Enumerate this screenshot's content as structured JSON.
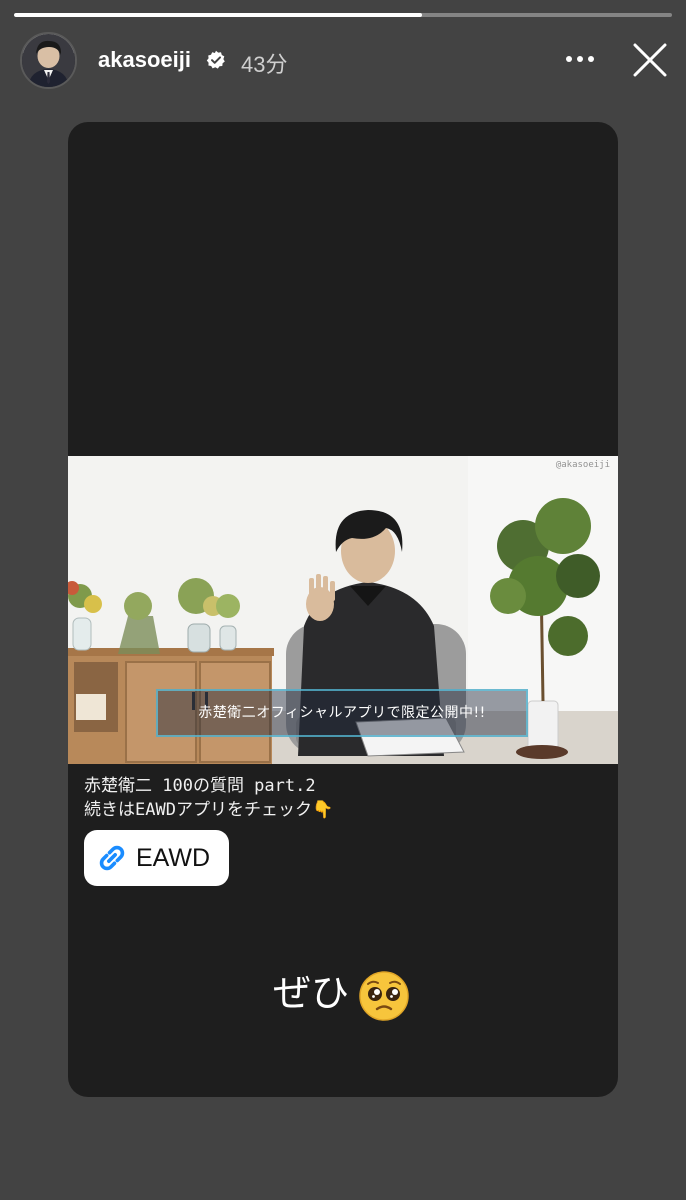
{
  "progress": 0.62,
  "header": {
    "username": "akasoeiji",
    "time": "43分"
  },
  "video": {
    "watermark": "@akasoeiji",
    "banner_text": "赤楚衛二オフィシャルアプリで限定公開中!!"
  },
  "caption": {
    "line1": "赤楚衛二 100の質問 part.2",
    "line2": "続きはEAWDアプリをチェック👇"
  },
  "link": {
    "label": "EAWD"
  },
  "sticker": {
    "text": "ぜひ"
  },
  "icons": [
    "avatar",
    "verified-badge-icon",
    "more-options-icon",
    "close-icon",
    "link-icon",
    "pleading-face-emoji-icon"
  ],
  "colors": {
    "background": "#434343",
    "card": "#1e1e1e",
    "link_blue": "#1a8cff",
    "verified_blue": "#3897f0"
  }
}
